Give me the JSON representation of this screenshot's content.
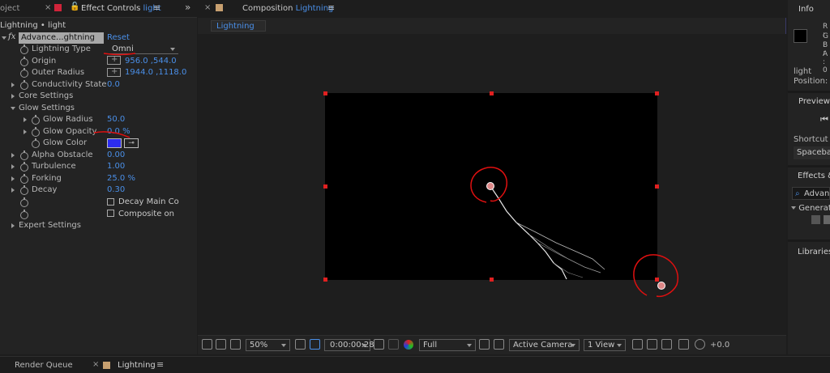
{
  "effect_panel": {
    "project_tab": "oject",
    "tab_label": "Effect Controls",
    "tab_layer": "light",
    "breadcrumb": "Lightning • light",
    "effect_name": "Advance...ghtning",
    "reset": "Reset",
    "props": [
      {
        "label": "Lightning Type",
        "value": "Omni"
      },
      {
        "label": "Origin",
        "value": "956.0 ,544.0"
      },
      {
        "label": "Outer Radius",
        "value": "1944.0 ,1118.0"
      },
      {
        "label": "Conductivity State",
        "value": "0.0"
      },
      {
        "label": "Core Settings"
      },
      {
        "label": "Glow Settings"
      },
      {
        "label": "Glow Radius",
        "value": "50.0"
      },
      {
        "label": "Glow Opacity",
        "value": "0.0 %"
      },
      {
        "label": "Glow Color"
      },
      {
        "label": "Alpha Obstacle",
        "value": "0.00"
      },
      {
        "label": "Turbulence",
        "value": "1.00"
      },
      {
        "label": "Forking",
        "value": "25.0 %"
      },
      {
        "label": "Decay",
        "value": "0.30"
      },
      {
        "label": "Decay Main Co"
      },
      {
        "label": "Composite on"
      },
      {
        "label": "Expert Settings"
      }
    ],
    "glow_color": "#2c2cf0"
  },
  "comp_panel": {
    "tab_prefix": "Composition",
    "tab_name": "Lightning",
    "subtab": "Lightning",
    "toolbar": {
      "zoom": "50%",
      "timecode": "0:00:00:28",
      "resolution": "Full",
      "camera": "Active Camera",
      "views": "1 View",
      "exposure": "+0.0"
    }
  },
  "right_panel": {
    "info_title": "Info",
    "rgba": [
      "R :",
      "G :",
      "B :",
      "A : 0"
    ],
    "layer_name": "light",
    "position_label": "Position: 9",
    "preview_title": "Preview",
    "shortcut_label": "Shortcut",
    "shortcut_value": "Spacebar",
    "effects_title": "Effects & P",
    "search_value": "Advan",
    "category": "Generat",
    "libraries": "Libraries"
  },
  "bottom": {
    "render_queue": "Render Queue",
    "timeline_tab": "Lightning"
  },
  "colors": {
    "accent": "#4a8fe8",
    "annotation": "#e01010",
    "handle": "#e02020"
  }
}
